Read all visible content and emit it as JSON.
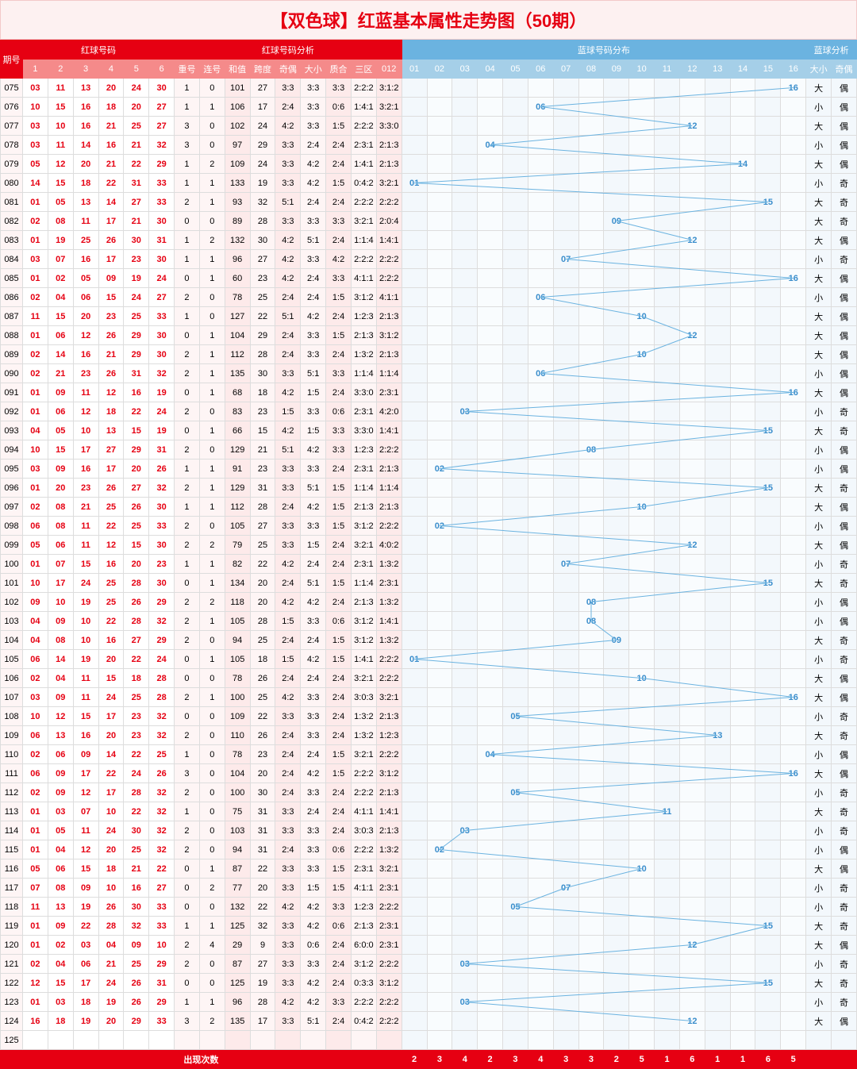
{
  "title": "【双色球】红蓝基本属性走势图（50期）",
  "headers": {
    "period": "期号",
    "red_group": "红球号码",
    "red_cols": [
      "1",
      "2",
      "3",
      "4",
      "5",
      "6"
    ],
    "analysis_group": "红球号码分析",
    "analysis_cols": [
      "重号",
      "连号",
      "和值",
      "跨度",
      "奇偶",
      "大小",
      "质合",
      "三区",
      "012"
    ],
    "blue_group": "蓝球号码分布",
    "blue_cols": [
      "01",
      "02",
      "03",
      "04",
      "05",
      "06",
      "07",
      "08",
      "09",
      "10",
      "11",
      "12",
      "13",
      "14",
      "15",
      "16"
    ],
    "blue_analysis_group": "蓝球分析",
    "blue_analysis_cols": [
      "大小",
      "奇偶"
    ]
  },
  "rows": [
    {
      "p": "075",
      "r": [
        "03",
        "11",
        "13",
        "20",
        "24",
        "30"
      ],
      "a": [
        "1",
        "0",
        "101",
        "27",
        "3:3",
        "3:3",
        "3:3",
        "2:2:2",
        "3:1:2"
      ],
      "b": 16,
      "ba": [
        "大",
        "偶"
      ]
    },
    {
      "p": "076",
      "r": [
        "10",
        "15",
        "16",
        "18",
        "20",
        "27"
      ],
      "a": [
        "1",
        "1",
        "106",
        "17",
        "2:4",
        "3:3",
        "0:6",
        "1:4:1",
        "3:2:1"
      ],
      "b": 6,
      "ba": [
        "小",
        "偶"
      ]
    },
    {
      "p": "077",
      "r": [
        "03",
        "10",
        "16",
        "21",
        "25",
        "27"
      ],
      "a": [
        "3",
        "0",
        "102",
        "24",
        "4:2",
        "3:3",
        "1:5",
        "2:2:2",
        "3:3:0"
      ],
      "b": 12,
      "ba": [
        "大",
        "偶"
      ]
    },
    {
      "p": "078",
      "r": [
        "03",
        "11",
        "14",
        "16",
        "21",
        "32"
      ],
      "a": [
        "3",
        "0",
        "97",
        "29",
        "3:3",
        "2:4",
        "2:4",
        "2:3:1",
        "2:1:3"
      ],
      "b": 4,
      "ba": [
        "小",
        "偶"
      ]
    },
    {
      "p": "079",
      "r": [
        "05",
        "12",
        "20",
        "21",
        "22",
        "29"
      ],
      "a": [
        "1",
        "2",
        "109",
        "24",
        "3:3",
        "4:2",
        "2:4",
        "1:4:1",
        "2:1:3"
      ],
      "b": 14,
      "ba": [
        "大",
        "偶"
      ]
    },
    {
      "p": "080",
      "r": [
        "14",
        "15",
        "18",
        "22",
        "31",
        "33"
      ],
      "a": [
        "1",
        "1",
        "133",
        "19",
        "3:3",
        "4:2",
        "1:5",
        "0:4:2",
        "3:2:1"
      ],
      "b": 1,
      "ba": [
        "小",
        "奇"
      ]
    },
    {
      "p": "081",
      "r": [
        "01",
        "05",
        "13",
        "14",
        "27",
        "33"
      ],
      "a": [
        "2",
        "1",
        "93",
        "32",
        "5:1",
        "2:4",
        "2:4",
        "2:2:2",
        "2:2:2"
      ],
      "b": 15,
      "ba": [
        "大",
        "奇"
      ]
    },
    {
      "p": "082",
      "r": [
        "02",
        "08",
        "11",
        "17",
        "21",
        "30"
      ],
      "a": [
        "0",
        "0",
        "89",
        "28",
        "3:3",
        "3:3",
        "3:3",
        "3:2:1",
        "2:0:4"
      ],
      "b": 9,
      "ba": [
        "大",
        "奇"
      ]
    },
    {
      "p": "083",
      "r": [
        "01",
        "19",
        "25",
        "26",
        "30",
        "31"
      ],
      "a": [
        "1",
        "2",
        "132",
        "30",
        "4:2",
        "5:1",
        "2:4",
        "1:1:4",
        "1:4:1"
      ],
      "b": 12,
      "ba": [
        "大",
        "偶"
      ]
    },
    {
      "p": "084",
      "r": [
        "03",
        "07",
        "16",
        "17",
        "23",
        "30"
      ],
      "a": [
        "1",
        "1",
        "96",
        "27",
        "4:2",
        "3:3",
        "4:2",
        "2:2:2",
        "2:2:2"
      ],
      "b": 7,
      "ba": [
        "小",
        "奇"
      ]
    },
    {
      "p": "085",
      "r": [
        "01",
        "02",
        "05",
        "09",
        "19",
        "24"
      ],
      "a": [
        "0",
        "1",
        "60",
        "23",
        "4:2",
        "2:4",
        "3:3",
        "4:1:1",
        "2:2:2"
      ],
      "b": 16,
      "ba": [
        "大",
        "偶"
      ]
    },
    {
      "p": "086",
      "r": [
        "02",
        "04",
        "06",
        "15",
        "24",
        "27"
      ],
      "a": [
        "2",
        "0",
        "78",
        "25",
        "2:4",
        "2:4",
        "1:5",
        "3:1:2",
        "4:1:1"
      ],
      "b": 6,
      "ba": [
        "小",
        "偶"
      ]
    },
    {
      "p": "087",
      "r": [
        "11",
        "15",
        "20",
        "23",
        "25",
        "33"
      ],
      "a": [
        "1",
        "0",
        "127",
        "22",
        "5:1",
        "4:2",
        "2:4",
        "1:2:3",
        "2:1:3"
      ],
      "b": 10,
      "ba": [
        "大",
        "偶"
      ]
    },
    {
      "p": "088",
      "r": [
        "01",
        "06",
        "12",
        "26",
        "29",
        "30"
      ],
      "a": [
        "0",
        "1",
        "104",
        "29",
        "2:4",
        "3:3",
        "1:5",
        "2:1:3",
        "3:1:2"
      ],
      "b": 12,
      "ba": [
        "大",
        "偶"
      ]
    },
    {
      "p": "089",
      "r": [
        "02",
        "14",
        "16",
        "21",
        "29",
        "30"
      ],
      "a": [
        "2",
        "1",
        "112",
        "28",
        "2:4",
        "3:3",
        "2:4",
        "1:3:2",
        "2:1:3"
      ],
      "b": 10,
      "ba": [
        "大",
        "偶"
      ]
    },
    {
      "p": "090",
      "r": [
        "02",
        "21",
        "23",
        "26",
        "31",
        "32"
      ],
      "a": [
        "2",
        "1",
        "135",
        "30",
        "3:3",
        "5:1",
        "3:3",
        "1:1:4",
        "1:1:4"
      ],
      "b": 6,
      "ba": [
        "小",
        "偶"
      ]
    },
    {
      "p": "091",
      "r": [
        "01",
        "09",
        "11",
        "12",
        "16",
        "19"
      ],
      "a": [
        "0",
        "1",
        "68",
        "18",
        "4:2",
        "1:5",
        "2:4",
        "3:3:0",
        "2:3:1"
      ],
      "b": 16,
      "ba": [
        "大",
        "偶"
      ]
    },
    {
      "p": "092",
      "r": [
        "01",
        "06",
        "12",
        "18",
        "22",
        "24"
      ],
      "a": [
        "2",
        "0",
        "83",
        "23",
        "1:5",
        "3:3",
        "0:6",
        "2:3:1",
        "4:2:0"
      ],
      "b": 3,
      "ba": [
        "小",
        "奇"
      ]
    },
    {
      "p": "093",
      "r": [
        "04",
        "05",
        "10",
        "13",
        "15",
        "19"
      ],
      "a": [
        "0",
        "1",
        "66",
        "15",
        "4:2",
        "1:5",
        "3:3",
        "3:3:0",
        "1:4:1"
      ],
      "b": 15,
      "ba": [
        "大",
        "奇"
      ]
    },
    {
      "p": "094",
      "r": [
        "10",
        "15",
        "17",
        "27",
        "29",
        "31"
      ],
      "a": [
        "2",
        "0",
        "129",
        "21",
        "5:1",
        "4:2",
        "3:3",
        "1:2:3",
        "2:2:2"
      ],
      "b": 8,
      "ba": [
        "小",
        "偶"
      ]
    },
    {
      "p": "095",
      "r": [
        "03",
        "09",
        "16",
        "17",
        "20",
        "26"
      ],
      "a": [
        "1",
        "1",
        "91",
        "23",
        "3:3",
        "3:3",
        "2:4",
        "2:3:1",
        "2:1:3"
      ],
      "b": 2,
      "ba": [
        "小",
        "偶"
      ]
    },
    {
      "p": "096",
      "r": [
        "01",
        "20",
        "23",
        "26",
        "27",
        "32"
      ],
      "a": [
        "2",
        "1",
        "129",
        "31",
        "3:3",
        "5:1",
        "1:5",
        "1:1:4",
        "1:1:4"
      ],
      "b": 15,
      "ba": [
        "大",
        "奇"
      ]
    },
    {
      "p": "097",
      "r": [
        "02",
        "08",
        "21",
        "25",
        "26",
        "30"
      ],
      "a": [
        "1",
        "1",
        "112",
        "28",
        "2:4",
        "4:2",
        "1:5",
        "2:1:3",
        "2:1:3"
      ],
      "b": 10,
      "ba": [
        "大",
        "偶"
      ]
    },
    {
      "p": "098",
      "r": [
        "06",
        "08",
        "11",
        "22",
        "25",
        "33"
      ],
      "a": [
        "2",
        "0",
        "105",
        "27",
        "3:3",
        "3:3",
        "1:5",
        "3:1:2",
        "2:2:2"
      ],
      "b": 2,
      "ba": [
        "小",
        "偶"
      ]
    },
    {
      "p": "099",
      "r": [
        "05",
        "06",
        "11",
        "12",
        "15",
        "30"
      ],
      "a": [
        "2",
        "2",
        "79",
        "25",
        "3:3",
        "1:5",
        "2:4",
        "3:2:1",
        "4:0:2"
      ],
      "b": 12,
      "ba": [
        "大",
        "偶"
      ]
    },
    {
      "p": "100",
      "r": [
        "01",
        "07",
        "15",
        "16",
        "20",
        "23"
      ],
      "a": [
        "1",
        "1",
        "82",
        "22",
        "4:2",
        "2:4",
        "2:4",
        "2:3:1",
        "1:3:2"
      ],
      "b": 7,
      "ba": [
        "小",
        "奇"
      ]
    },
    {
      "p": "101",
      "r": [
        "10",
        "17",
        "24",
        "25",
        "28",
        "30"
      ],
      "a": [
        "0",
        "1",
        "134",
        "20",
        "2:4",
        "5:1",
        "1:5",
        "1:1:4",
        "2:3:1"
      ],
      "b": 15,
      "ba": [
        "大",
        "奇"
      ]
    },
    {
      "p": "102",
      "r": [
        "09",
        "10",
        "19",
        "25",
        "26",
        "29"
      ],
      "a": [
        "2",
        "2",
        "118",
        "20",
        "4:2",
        "4:2",
        "2:4",
        "2:1:3",
        "1:3:2"
      ],
      "b": 8,
      "ba": [
        "小",
        "偶"
      ]
    },
    {
      "p": "103",
      "r": [
        "04",
        "09",
        "10",
        "22",
        "28",
        "32"
      ],
      "a": [
        "2",
        "1",
        "105",
        "28",
        "1:5",
        "3:3",
        "0:6",
        "3:1:2",
        "1:4:1"
      ],
      "b": 8,
      "ba": [
        "小",
        "偶"
      ]
    },
    {
      "p": "104",
      "r": [
        "04",
        "08",
        "10",
        "16",
        "27",
        "29"
      ],
      "a": [
        "2",
        "0",
        "94",
        "25",
        "2:4",
        "2:4",
        "1:5",
        "3:1:2",
        "1:3:2"
      ],
      "b": 9,
      "ba": [
        "大",
        "奇"
      ]
    },
    {
      "p": "105",
      "r": [
        "06",
        "14",
        "19",
        "20",
        "22",
        "24"
      ],
      "a": [
        "0",
        "1",
        "105",
        "18",
        "1:5",
        "4:2",
        "1:5",
        "1:4:1",
        "2:2:2"
      ],
      "b": 1,
      "ba": [
        "小",
        "奇"
      ]
    },
    {
      "p": "106",
      "r": [
        "02",
        "04",
        "11",
        "15",
        "18",
        "28"
      ],
      "a": [
        "0",
        "0",
        "78",
        "26",
        "2:4",
        "2:4",
        "2:4",
        "3:2:1",
        "2:2:2"
      ],
      "b": 10,
      "ba": [
        "大",
        "偶"
      ]
    },
    {
      "p": "107",
      "r": [
        "03",
        "09",
        "11",
        "24",
        "25",
        "28"
      ],
      "a": [
        "2",
        "1",
        "100",
        "25",
        "4:2",
        "3:3",
        "2:4",
        "3:0:3",
        "3:2:1"
      ],
      "b": 16,
      "ba": [
        "大",
        "偶"
      ]
    },
    {
      "p": "108",
      "r": [
        "10",
        "12",
        "15",
        "17",
        "23",
        "32"
      ],
      "a": [
        "0",
        "0",
        "109",
        "22",
        "3:3",
        "3:3",
        "2:4",
        "1:3:2",
        "2:1:3"
      ],
      "b": 5,
      "ba": [
        "小",
        "奇"
      ]
    },
    {
      "p": "109",
      "r": [
        "06",
        "13",
        "16",
        "20",
        "23",
        "32"
      ],
      "a": [
        "2",
        "0",
        "110",
        "26",
        "2:4",
        "3:3",
        "2:4",
        "1:3:2",
        "1:2:3"
      ],
      "b": 13,
      "ba": [
        "大",
        "奇"
      ]
    },
    {
      "p": "110",
      "r": [
        "02",
        "06",
        "09",
        "14",
        "22",
        "25"
      ],
      "a": [
        "1",
        "0",
        "78",
        "23",
        "2:4",
        "2:4",
        "1:5",
        "3:2:1",
        "2:2:2"
      ],
      "b": 4,
      "ba": [
        "小",
        "偶"
      ]
    },
    {
      "p": "111",
      "r": [
        "06",
        "09",
        "17",
        "22",
        "24",
        "26"
      ],
      "a": [
        "3",
        "0",
        "104",
        "20",
        "2:4",
        "4:2",
        "1:5",
        "2:2:2",
        "3:1:2"
      ],
      "b": 16,
      "ba": [
        "大",
        "偶"
      ]
    },
    {
      "p": "112",
      "r": [
        "02",
        "09",
        "12",
        "17",
        "28",
        "32"
      ],
      "a": [
        "2",
        "0",
        "100",
        "30",
        "2:4",
        "3:3",
        "2:4",
        "2:2:2",
        "2:1:3"
      ],
      "b": 5,
      "ba": [
        "小",
        "奇"
      ]
    },
    {
      "p": "113",
      "r": [
        "01",
        "03",
        "07",
        "10",
        "22",
        "32"
      ],
      "a": [
        "1",
        "0",
        "75",
        "31",
        "3:3",
        "2:4",
        "2:4",
        "4:1:1",
        "1:4:1"
      ],
      "b": 11,
      "ba": [
        "大",
        "奇"
      ]
    },
    {
      "p": "114",
      "r": [
        "01",
        "05",
        "11",
        "24",
        "30",
        "32"
      ],
      "a": [
        "2",
        "0",
        "103",
        "31",
        "3:3",
        "3:3",
        "2:4",
        "3:0:3",
        "2:1:3"
      ],
      "b": 3,
      "ba": [
        "小",
        "奇"
      ]
    },
    {
      "p": "115",
      "r": [
        "01",
        "04",
        "12",
        "20",
        "25",
        "32"
      ],
      "a": [
        "2",
        "0",
        "94",
        "31",
        "2:4",
        "3:3",
        "0:6",
        "2:2:2",
        "1:3:2"
      ],
      "b": 2,
      "ba": [
        "小",
        "偶"
      ]
    },
    {
      "p": "116",
      "r": [
        "05",
        "06",
        "15",
        "18",
        "21",
        "22"
      ],
      "a": [
        "0",
        "1",
        "87",
        "22",
        "3:3",
        "3:3",
        "1:5",
        "2:3:1",
        "3:2:1"
      ],
      "b": 10,
      "ba": [
        "大",
        "偶"
      ]
    },
    {
      "p": "117",
      "r": [
        "07",
        "08",
        "09",
        "10",
        "16",
        "27"
      ],
      "a": [
        "0",
        "2",
        "77",
        "20",
        "3:3",
        "1:5",
        "1:5",
        "4:1:1",
        "2:3:1"
      ],
      "b": 7,
      "ba": [
        "小",
        "奇"
      ]
    },
    {
      "p": "118",
      "r": [
        "11",
        "13",
        "19",
        "26",
        "30",
        "33"
      ],
      "a": [
        "0",
        "0",
        "132",
        "22",
        "4:2",
        "4:2",
        "3:3",
        "1:2:3",
        "2:2:2"
      ],
      "b": 5,
      "ba": [
        "小",
        "奇"
      ]
    },
    {
      "p": "119",
      "r": [
        "01",
        "09",
        "22",
        "28",
        "32",
        "33"
      ],
      "a": [
        "1",
        "1",
        "125",
        "32",
        "3:3",
        "4:2",
        "0:6",
        "2:1:3",
        "2:3:1"
      ],
      "b": 15,
      "ba": [
        "大",
        "奇"
      ]
    },
    {
      "p": "120",
      "r": [
        "01",
        "02",
        "03",
        "04",
        "09",
        "10"
      ],
      "a": [
        "2",
        "4",
        "29",
        "9",
        "3:3",
        "0:6",
        "2:4",
        "6:0:0",
        "2:3:1"
      ],
      "b": 12,
      "ba": [
        "大",
        "偶"
      ]
    },
    {
      "p": "121",
      "r": [
        "02",
        "04",
        "06",
        "21",
        "25",
        "29"
      ],
      "a": [
        "2",
        "0",
        "87",
        "27",
        "3:3",
        "3:3",
        "2:4",
        "3:1:2",
        "2:2:2"
      ],
      "b": 3,
      "ba": [
        "小",
        "奇"
      ]
    },
    {
      "p": "122",
      "r": [
        "12",
        "15",
        "17",
        "24",
        "26",
        "31"
      ],
      "a": [
        "0",
        "0",
        "125",
        "19",
        "3:3",
        "4:2",
        "2:4",
        "0:3:3",
        "3:1:2"
      ],
      "b": 15,
      "ba": [
        "大",
        "奇"
      ]
    },
    {
      "p": "123",
      "r": [
        "01",
        "03",
        "18",
        "19",
        "26",
        "29"
      ],
      "a": [
        "1",
        "1",
        "96",
        "28",
        "4:2",
        "4:2",
        "3:3",
        "2:2:2",
        "2:2:2"
      ],
      "b": 3,
      "ba": [
        "小",
        "奇"
      ]
    },
    {
      "p": "124",
      "r": [
        "16",
        "18",
        "19",
        "20",
        "29",
        "33"
      ],
      "a": [
        "3",
        "2",
        "135",
        "17",
        "3:3",
        "5:1",
        "2:4",
        "0:4:2",
        "2:2:2"
      ],
      "b": 12,
      "ba": [
        "大",
        "偶"
      ]
    }
  ],
  "empty_row": "125",
  "footer_label": "出现次数",
  "blue_occurrences": [
    "2",
    "3",
    "4",
    "2",
    "3",
    "4",
    "3",
    "3",
    "2",
    "5",
    "1",
    "6",
    "1",
    "1",
    "6",
    "5"
  ]
}
